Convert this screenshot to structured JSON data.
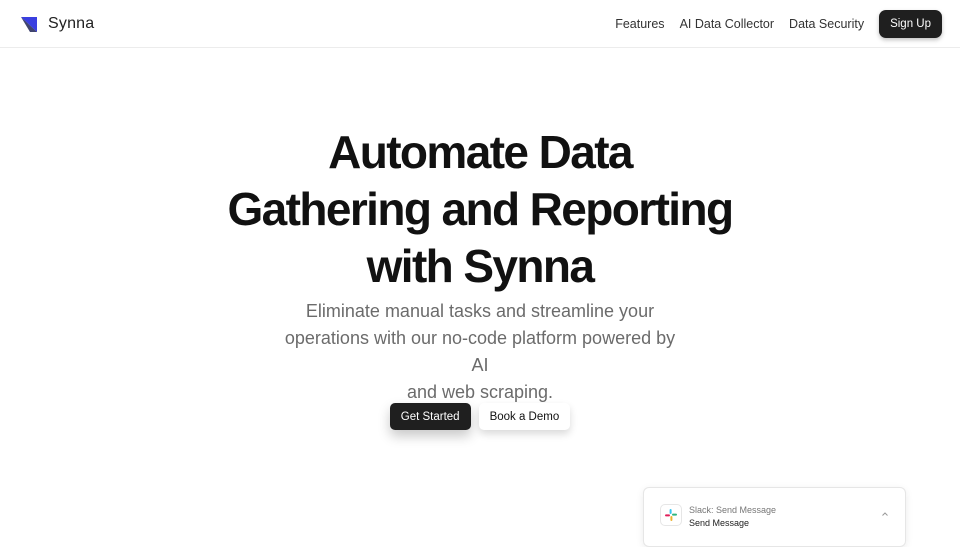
{
  "brand": {
    "name": "Synna",
    "logo_icon": "triangle-logo-icon",
    "colors": {
      "logo_blue": "#3a3fe0",
      "logo_navy": "#1f2356"
    }
  },
  "nav": {
    "links": [
      "Features",
      "AI Data Collector",
      "Data Security"
    ],
    "signup_label": "Sign Up"
  },
  "hero": {
    "title_lines": [
      "Automate Data",
      "Gathering and Reporting",
      "with Synna"
    ],
    "subtitle_lines": [
      "Eliminate manual tasks and streamline your",
      "operations with our no-code platform powered by AI",
      "and web scraping."
    ],
    "get_started_label": "Get Started",
    "book_demo_label": "Book a Demo"
  },
  "slack_card": {
    "icon": "slack-icon",
    "app_label": "Slack: Send Message",
    "action_label": "Send Message",
    "toggle_icon": "chevron-up-icon"
  }
}
